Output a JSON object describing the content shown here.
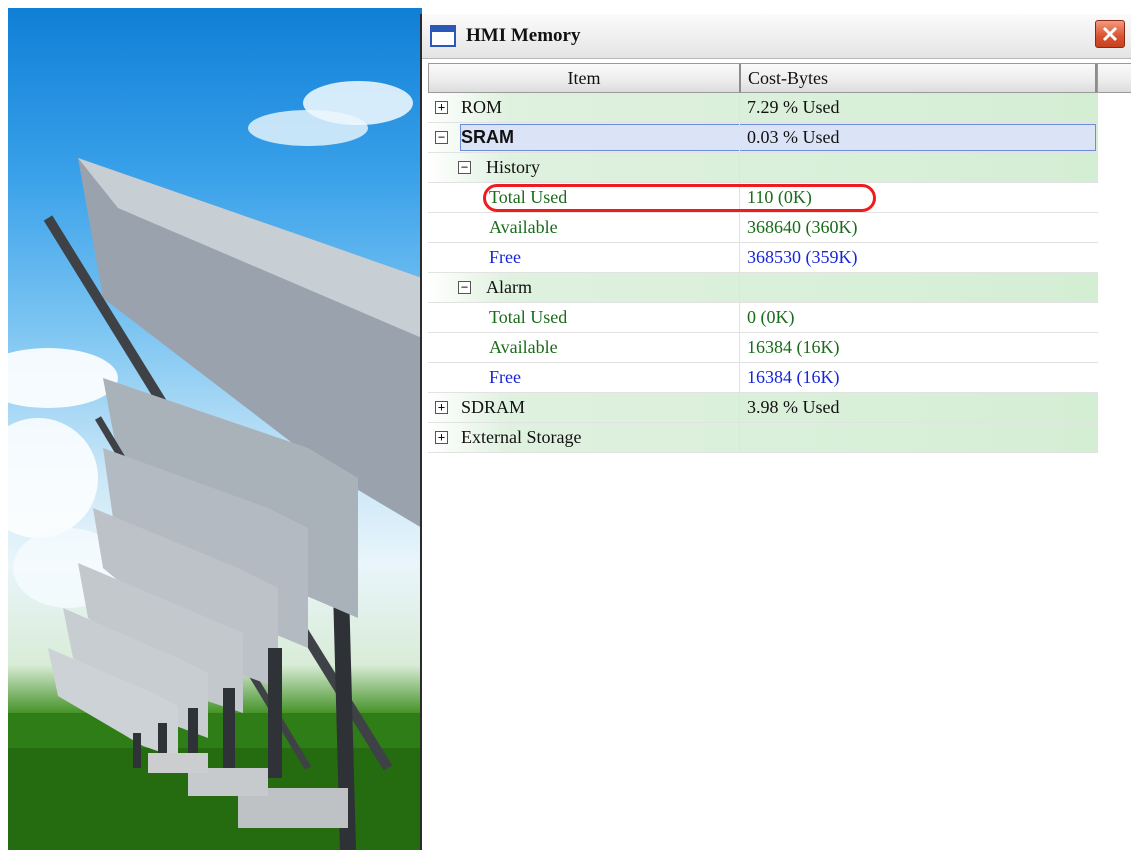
{
  "window": {
    "title": "HMI Memory",
    "icons": {
      "app": "window-icon",
      "close": "close-icon"
    }
  },
  "columns": {
    "item": "Item",
    "cost": "Cost-Bytes"
  },
  "rows": [
    {
      "label": "ROM",
      "value": "7.29 % Used"
    },
    {
      "label": "SRAM",
      "value": "0.03 % Used"
    },
    {
      "label": "History",
      "value": ""
    },
    {
      "label": "Total Used",
      "value": "110 (0K)"
    },
    {
      "label": "Available",
      "value": "368640 (360K)"
    },
    {
      "label": "Free",
      "value": "368530 (359K)"
    },
    {
      "label": "Alarm",
      "value": ""
    },
    {
      "label": "Total Used",
      "value": "0 (0K)"
    },
    {
      "label": "Available",
      "value": "16384 (16K)"
    },
    {
      "label": "Free",
      "value": "16384 (16K)"
    },
    {
      "label": "SDRAM",
      "value": "3.98 % Used"
    },
    {
      "label": "External Storage",
      "value": ""
    }
  ],
  "colors": {
    "total_available": "#1a6b1a",
    "free": "#1626d9",
    "highlight_oval": "#ee1c1c",
    "row_tint": "#d4eed4"
  }
}
